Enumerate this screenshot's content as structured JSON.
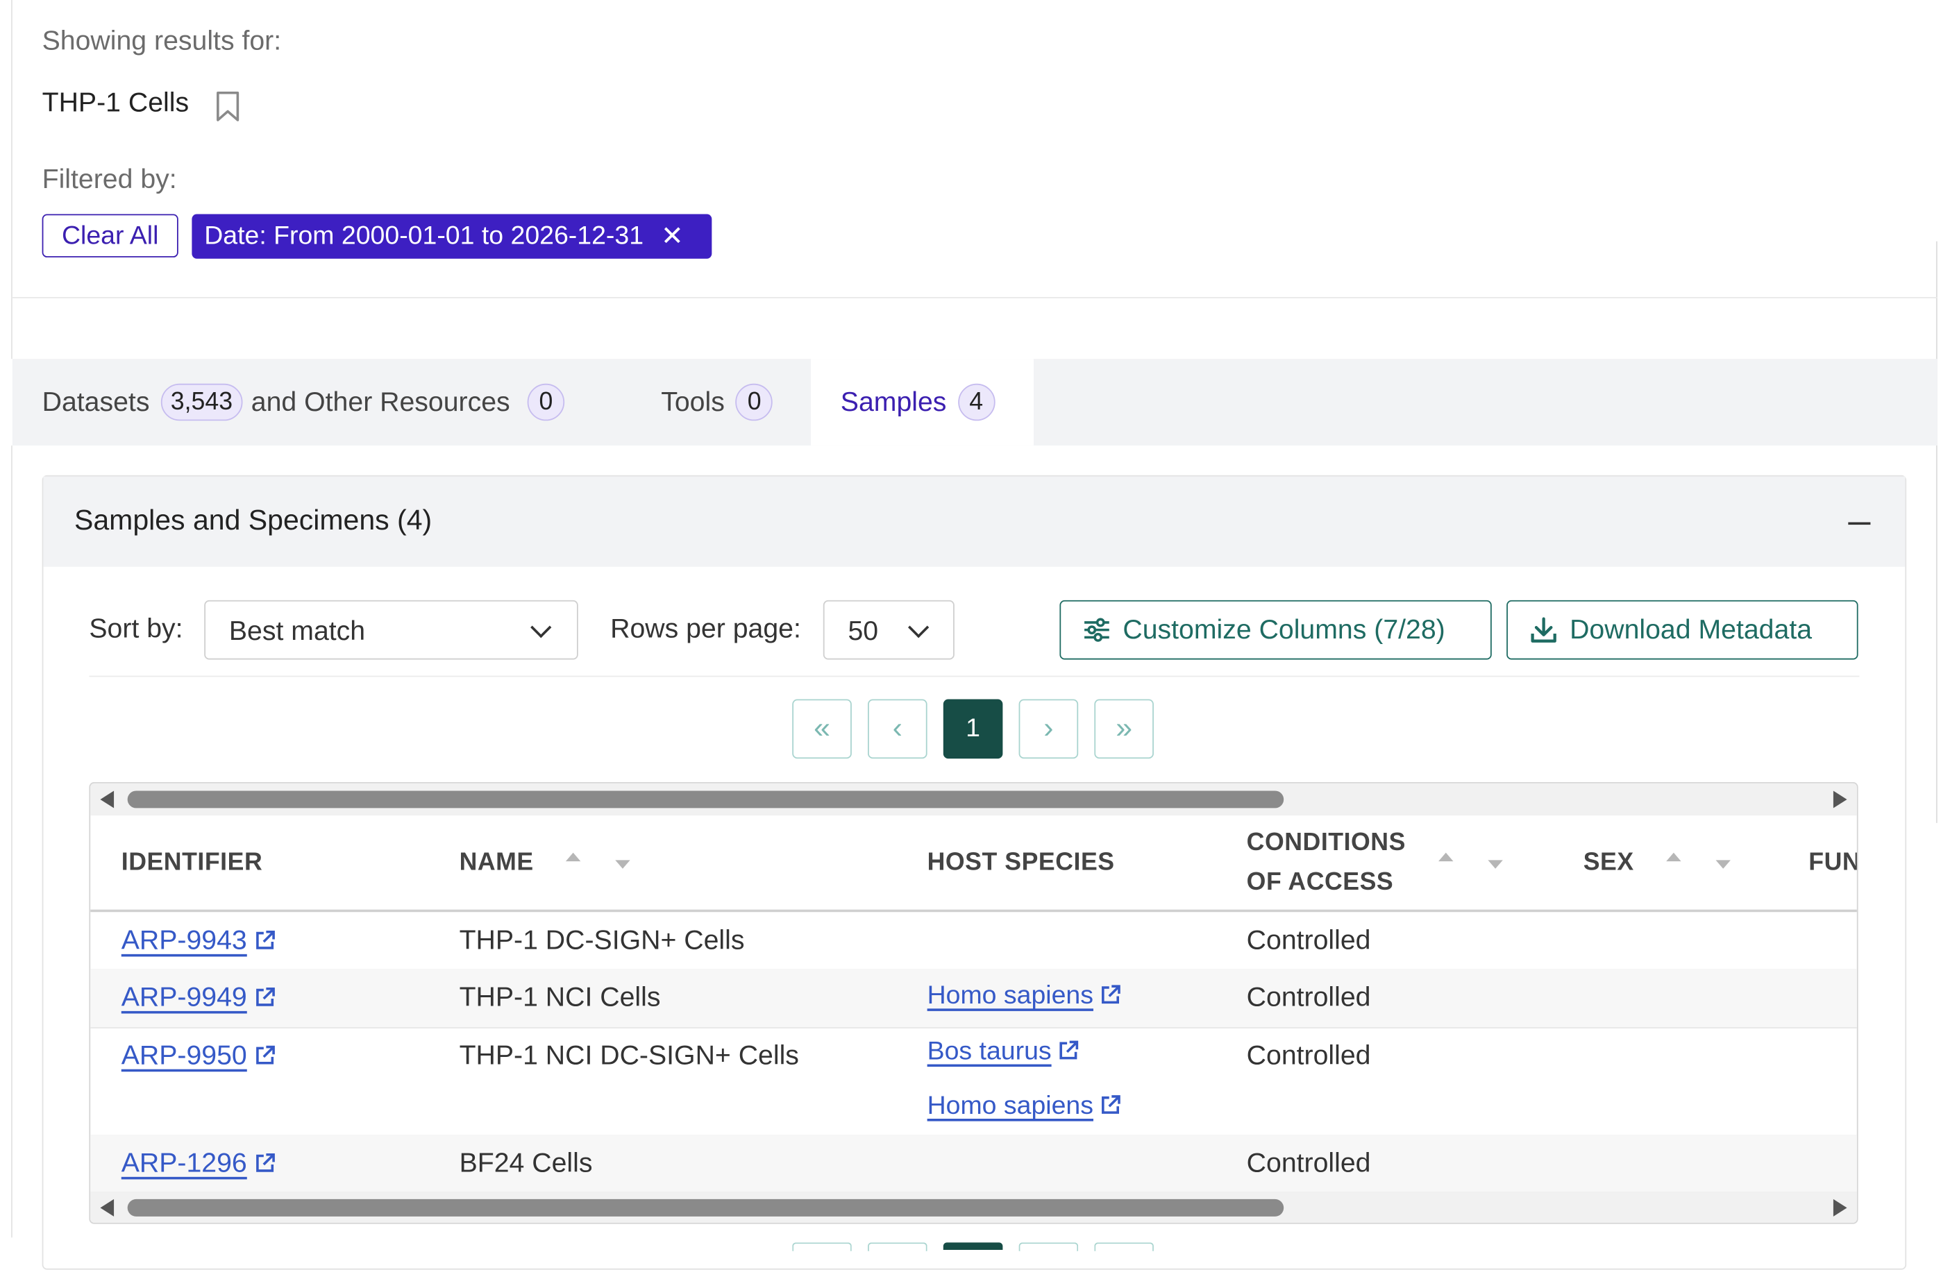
{
  "results": {
    "showing_label": "Showing results for:",
    "query": "THP-1 Cells",
    "filtered_label": "Filtered by:",
    "clear_all": "Clear All",
    "filter_chip": "Date: From 2000-01-01 to 2026-12-31"
  },
  "tabs": [
    {
      "label": "Datasets",
      "count": "3,543"
    },
    {
      "label": "and Other Resources",
      "count": "0"
    },
    {
      "label": "Tools",
      "count": "0"
    },
    {
      "label": "Samples",
      "count": "4",
      "active": true
    }
  ],
  "panel": {
    "title": "Samples and Specimens (4)",
    "sort_label": "Sort by:",
    "sort_value": "Best match",
    "rows_label": "Rows per page:",
    "rows_value": "50",
    "customize_button": "Customize Columns (7/28)",
    "download_button": "Download Metadata",
    "current_page": "1"
  },
  "table": {
    "headers": [
      "IDENTIFIER",
      "NAME",
      "HOST SPECIES",
      "CONDITIONS",
      "OF ACCESS",
      "SEX",
      "FUN"
    ],
    "rows": [
      {
        "id": "ARP-9943",
        "name": "THP-1 DC-SIGN+ Cells",
        "hosts": [],
        "access": "Controlled"
      },
      {
        "id": "ARP-9949",
        "name": "THP-1 NCI Cells",
        "hosts": [
          "Homo sapiens"
        ],
        "access": "Controlled"
      },
      {
        "id": "ARP-9950",
        "name": "THP-1 NCI DC-SIGN+ Cells",
        "hosts": [
          "Bos taurus",
          "Homo sapiens"
        ],
        "access": "Controlled"
      },
      {
        "id": "ARP-1296",
        "name": "BF24 Cells",
        "hosts": [],
        "access": "Controlled"
      }
    ]
  },
  "colors": {
    "primary": "#3d1fc2",
    "teal": "#1e6b62",
    "link": "#3559c7"
  }
}
